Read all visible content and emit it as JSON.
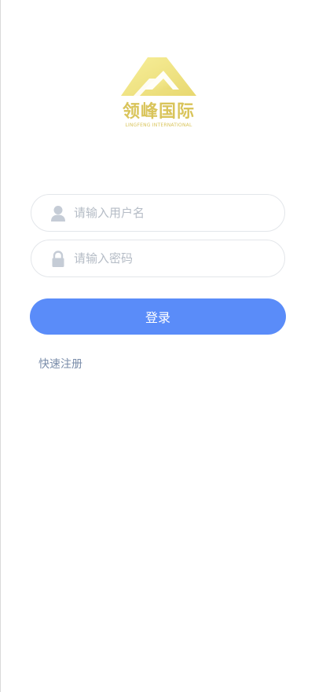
{
  "brand": {
    "name_cn": "领峰国际",
    "name_en": "LINGFENG INTERNATIONAL",
    "logo_icon": "mountain-triangle-logo-icon",
    "color": "#d9c45a"
  },
  "form": {
    "username": {
      "icon": "user-icon",
      "placeholder": "请输入用户名",
      "value": ""
    },
    "password": {
      "icon": "lock-icon",
      "placeholder": "请输入密码",
      "value": ""
    },
    "login_label": "登录",
    "register_label": "快速注册"
  },
  "colors": {
    "accent": "#5a8cf9",
    "link": "#7a8daa",
    "icon": "#c5ccd6",
    "border": "#e3e6ea"
  }
}
